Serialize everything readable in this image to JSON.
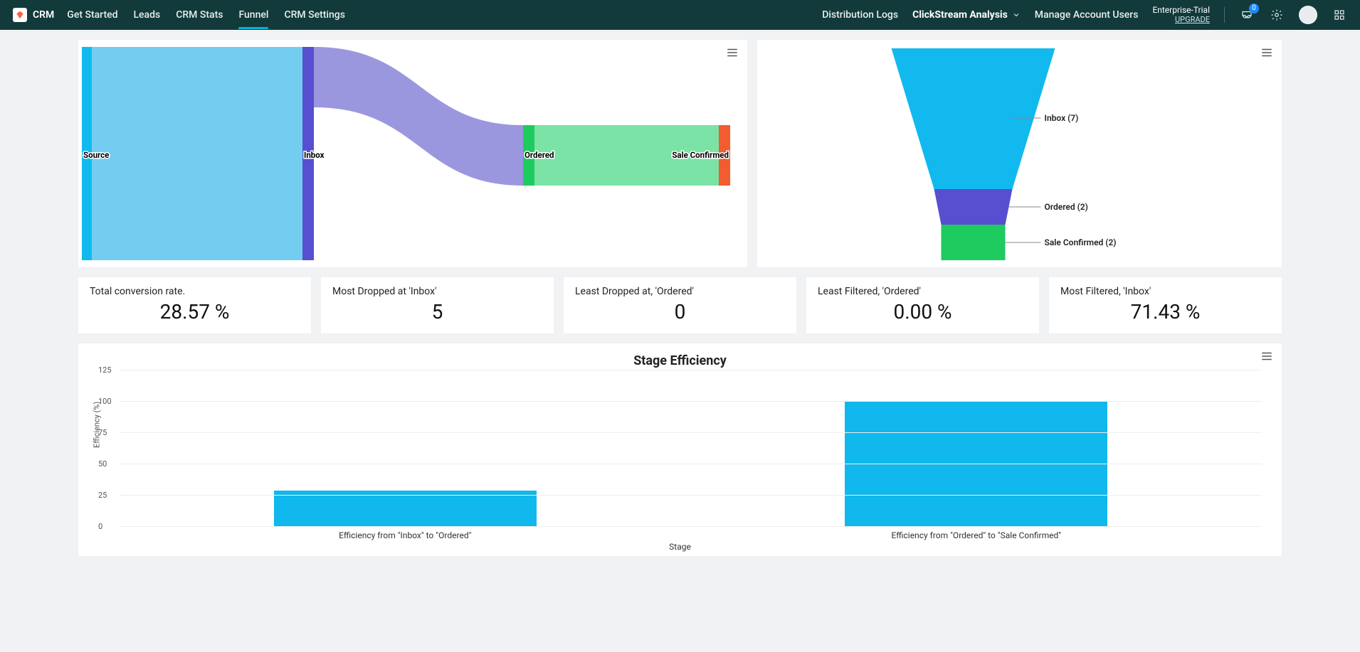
{
  "topbar": {
    "brand": "CRM",
    "nav": [
      "Get Started",
      "Leads",
      "CRM Stats",
      "Funnel",
      "CRM Settings"
    ],
    "active_index": 3,
    "right": {
      "distribution": "Distribution Logs",
      "clickstream": "ClickStream Analysis",
      "manage": "Manage Account Users",
      "trial_line1": "Enterprise-Trial",
      "trial_line2": "UPGRADE",
      "notification_count": "0"
    }
  },
  "sankey": {
    "labels": [
      "Source",
      "Inbox",
      "Ordered",
      "Sale Confirmed"
    ]
  },
  "funnel": {
    "items": [
      {
        "label": "Inbox (7)"
      },
      {
        "label": "Ordered (2)"
      },
      {
        "label": "Sale Confirmed (2)"
      }
    ]
  },
  "stats": [
    {
      "label": "Total conversion rate.",
      "value": "28.57 %"
    },
    {
      "label": "Most Dropped at 'Inbox'",
      "value": "5"
    },
    {
      "label": "Least Dropped at, 'Ordered'",
      "value": "0"
    },
    {
      "label": "Least Filtered, 'Ordered'",
      "value": "0.00 %"
    },
    {
      "label": "Most Filtered, 'Inbox'",
      "value": "71.43 %"
    }
  ],
  "chart_data": {
    "type": "bar",
    "title": "Stage Efficiency",
    "xlabel": "Stage",
    "ylabel": "Efficiency (%)",
    "ylim": [
      0,
      125
    ],
    "yticks": [
      0,
      25,
      50,
      75,
      100,
      125
    ],
    "categories": [
      "Efficiency from \"Inbox\" to \"Ordered\"",
      "Efficiency from \"Ordered\" to \"Sale Confirmed\""
    ],
    "values": [
      28.57,
      100
    ],
    "color": "#11b8ed"
  }
}
